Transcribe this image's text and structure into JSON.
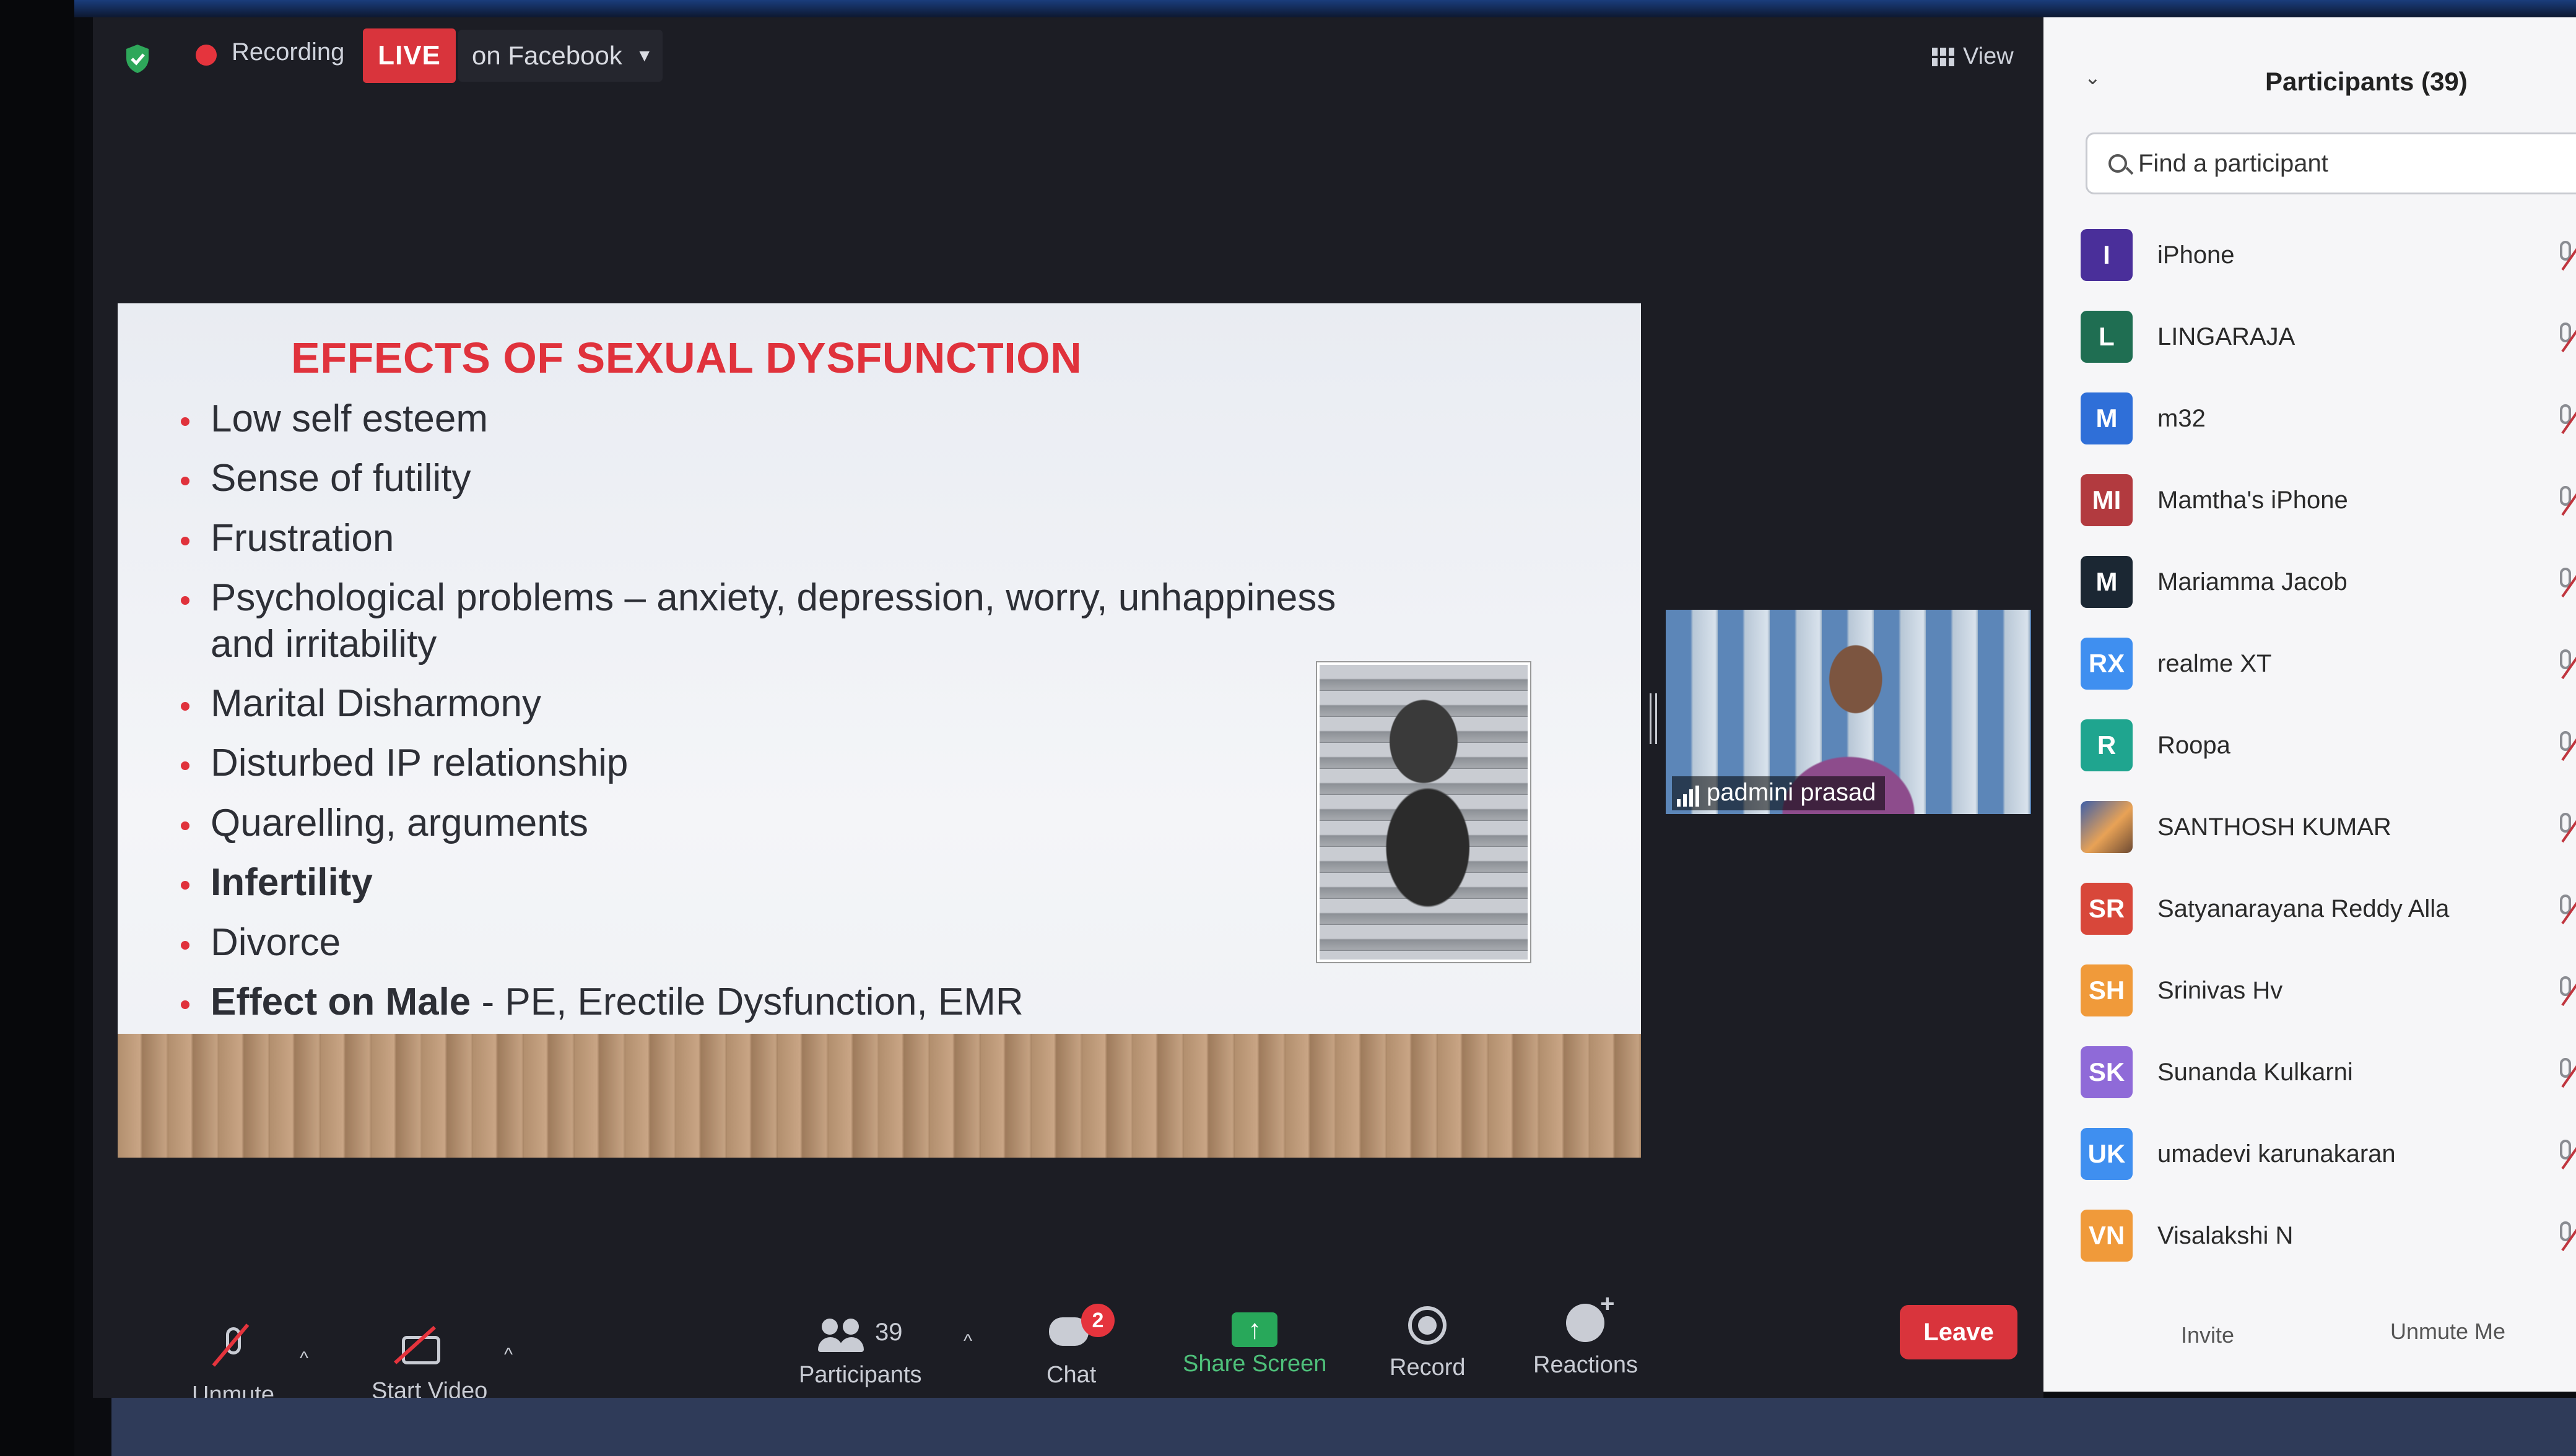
{
  "top_bar": {
    "recording_label": "Recording",
    "live_badge": "LIVE",
    "live_destination": "on Facebook",
    "view_label": "View"
  },
  "slide": {
    "title": "EFFECTS OF SEXUAL DYSFUNCTION",
    "bullets": [
      "Low self esteem",
      "Sense of futility",
      "Frustration",
      "Psychological problems – anxiety, depression, worry, unhappiness and irritability",
      "Marital Disharmony",
      "Disturbed IP relationship",
      "Quarelling, arguments",
      "Infertility",
      "Divorce"
    ],
    "last_bullet_bold": "Effect on Male",
    "last_bullet_rest": " - PE, Erectile Dysfunction,  EMR"
  },
  "speaker": {
    "name": "padmini prasad"
  },
  "toolbar": {
    "unmute_label": "Unmute",
    "start_video_label": "Start Video",
    "participants_label": "Participants",
    "participants_count": "39",
    "chat_label": "Chat",
    "chat_badge": "2",
    "share_screen_label": "Share Screen",
    "record_label": "Record",
    "reactions_label": "Reactions",
    "leave_label": "Leave"
  },
  "participants_panel": {
    "title": "Participants (39)",
    "search_placeholder": "Find a participant",
    "invite_label": "Invite",
    "unmute_me_label": "Unmute Me",
    "participants": [
      {
        "initials": "I",
        "name": "iPhone",
        "color": "#4a2f9a"
      },
      {
        "initials": "L",
        "name": "LINGARAJA",
        "color": "#1f6e52"
      },
      {
        "initials": "M",
        "name": "m32",
        "color": "#2f6fd8"
      },
      {
        "initials": "MI",
        "name": "Mamtha's iPhone",
        "color": "#b23a3f"
      },
      {
        "initials": "M",
        "name": "Mariamma Jacob",
        "color": "#1b2733"
      },
      {
        "initials": "RX",
        "name": "realme XT",
        "color": "#3f8ff0"
      },
      {
        "initials": "R",
        "name": "Roopa",
        "color": "#1fa58f"
      },
      {
        "initials": "",
        "name": "SANTHOSH KUMAR",
        "color": "photo"
      },
      {
        "initials": "SR",
        "name": "Satyanarayana Reddy Alla",
        "color": "#d8473a"
      },
      {
        "initials": "SH",
        "name": "Srinivas Hv",
        "color": "#f09a3a"
      },
      {
        "initials": "SK",
        "name": "Sunanda Kulkarni",
        "color": "#8f6ad8"
      },
      {
        "initials": "UK",
        "name": "umadevi karunakaran",
        "color": "#3f8ff0"
      },
      {
        "initials": "VN",
        "name": "Visalakshi N",
        "color": "#f09a3a"
      }
    ]
  },
  "colors": {
    "live_red": "#d9343c",
    "slide_title_red": "#e0323c",
    "share_green": "#28a85a"
  }
}
